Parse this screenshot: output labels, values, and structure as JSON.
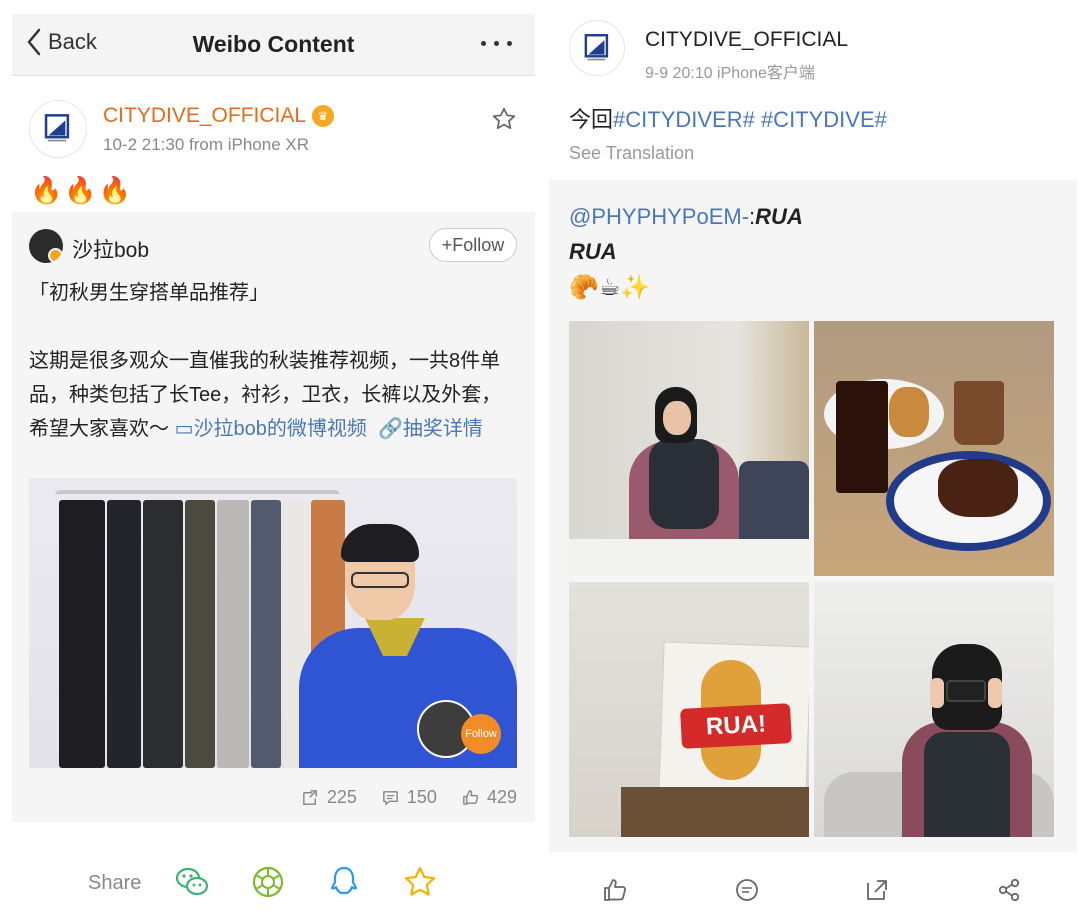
{
  "left": {
    "nav": {
      "back_label": "Back",
      "title": "Weibo Content"
    },
    "post": {
      "author": "CITYDIVE_OFFICIAL",
      "meta": "10-2 21:30  from iPhone XR",
      "content": "🔥🔥🔥"
    },
    "repost": {
      "author": "沙拉bob",
      "follow_label": "+Follow",
      "title": "「初秋男生穿搭单品推荐」",
      "body": "这期是很多观众一直催我的秋装推荐视频，一共8件单品，种类包括了长Tee，衬衫，卫衣，长裤以及外套，希望大家喜欢～ ",
      "video_link": "沙拉bob的微博视频",
      "lottery_link": "抽奖详情",
      "mini_follow_label": "Follow"
    },
    "counts": {
      "reposts": "225",
      "comments": "150",
      "likes": "429"
    },
    "share": {
      "label": "Share"
    }
  },
  "right": {
    "post": {
      "author": "CITYDIVE_OFFICIAL",
      "meta": "9-9 20:10   iPhone客户端",
      "text_prefix": "今回",
      "tags": "#CITYDIVER# #CITYDIVE#",
      "see_translation": "See Translation"
    },
    "repost": {
      "mention": "@PHYPHYPoEM-",
      "line1_suffix": "RUA",
      "line2": "RUA",
      "emojis": "🥐☕✨",
      "sign_text": "RUA!"
    }
  },
  "colors": {
    "brand_orange": "#e86a1c",
    "link_blue": "#4a78b5",
    "follow_orange": "#f28c28"
  }
}
